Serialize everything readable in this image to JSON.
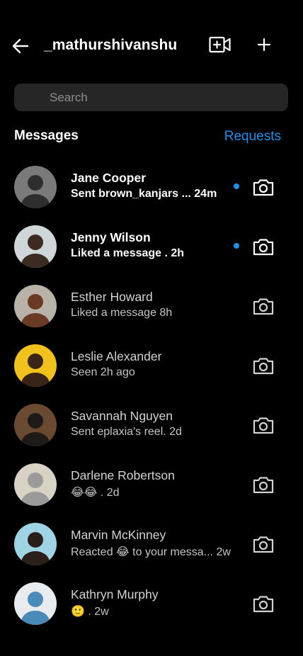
{
  "header": {
    "username": "_mathurshivanshu",
    "back_icon": "arrow-left-icon",
    "video_icon": "video-plus-icon",
    "plus_icon": "plus-icon"
  },
  "search": {
    "placeholder": "Search",
    "value": ""
  },
  "section": {
    "title": "Messages",
    "requests_label": "Requests"
  },
  "colors": {
    "accent": "#1f8fe8",
    "background": "#000000",
    "search_bg": "#262626"
  },
  "conversations": [
    {
      "name": "Jane Cooper",
      "preview": "Sent brown_kanjars ... 24m",
      "unread": true,
      "avatar_bg": "#7a7a7a",
      "avatar_fg": "#2e2e2e"
    },
    {
      "name": "Jenny Wilson",
      "preview": "Liked a message . 2h",
      "unread": true,
      "avatar_bg": "#cfd6d8",
      "avatar_fg": "#3b2b22"
    },
    {
      "name": "Esther Howard",
      "preview": "Liked a message 8h",
      "unread": false,
      "avatar_bg": "#b9b2a8",
      "avatar_fg": "#6b3a24"
    },
    {
      "name": "Leslie Alexander",
      "preview": "Seen 2h ago",
      "unread": false,
      "avatar_bg": "#f2c21c",
      "avatar_fg": "#3a2418"
    },
    {
      "name": "Savannah Nguyen",
      "preview": "Sent eplaxia's reel. 2d",
      "unread": false,
      "avatar_bg": "#6b4a32",
      "avatar_fg": "#1e1a18"
    },
    {
      "name": "Darlene Robertson",
      "preview": "😂😂 . 2d",
      "unread": false,
      "avatar_bg": "#d8d2c4",
      "avatar_fg": "#9a9a9a"
    },
    {
      "name": "Marvin McKinney",
      "preview": "Reacted 😂 to your messa... 2w",
      "unread": false,
      "avatar_bg": "#9fd4e4",
      "avatar_fg": "#2a1f1a"
    },
    {
      "name": "Kathryn Murphy",
      "preview": "🙂 . 2w",
      "unread": false,
      "avatar_bg": "#e9ecee",
      "avatar_fg": "#4a8ab8"
    }
  ]
}
